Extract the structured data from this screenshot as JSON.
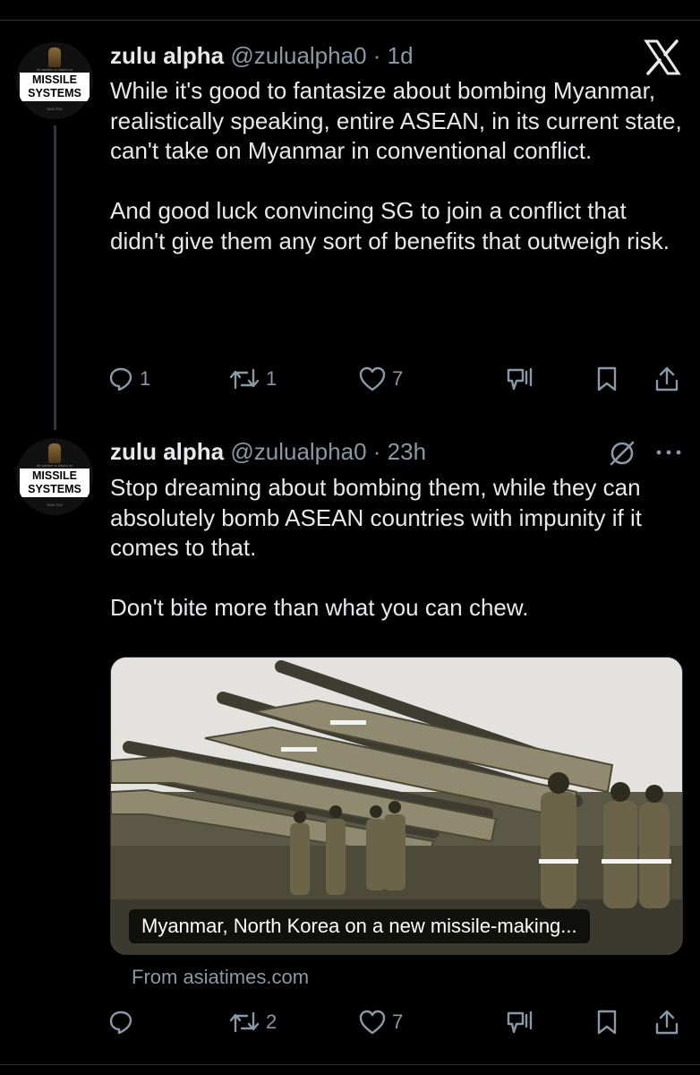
{
  "close_icon": "x-logo-icon",
  "tweets": [
    {
      "avatar": {
        "small_text": "All warfare is based on",
        "logo_line1": "MISSILE",
        "logo_line2": "SYSTEMS",
        "bottom_text": "SUN TZU"
      },
      "name": "zulu alpha",
      "handle": "@zulualpha0",
      "time": "· 1d",
      "text": "While it's good to fantasize about bombing Myanmar, realistically speaking, entire ASEAN, in its current state, can't take on Myanmar in conventional conflict.\n\nAnd good luck convincing SG to join a conflict that didn't give them any sort of benefits that outweigh risk.",
      "actions": {
        "replies": "1",
        "reposts": "1",
        "likes": "7"
      }
    },
    {
      "avatar": {
        "small_text": "All warfare is based on",
        "logo_line1": "MISSILE",
        "logo_line2": "SYSTEMS",
        "bottom_text": "SUN TZU"
      },
      "name": "zulu alpha",
      "handle": "@zulualpha0",
      "time": "· 23h",
      "text": "Stop dreaming about bombing them, while they can absolutely bomb ASEAN countries with impunity if it comes to that.\n\nDon't bite more than what you can chew.",
      "card": {
        "caption": "Myanmar, North Korea on a new missile-making...",
        "source": "From asiatimes.com"
      },
      "actions": {
        "replies": "",
        "reposts": "2",
        "likes": "7"
      }
    }
  ],
  "colors": {
    "background": "#000000",
    "text": "#e7e9ea",
    "muted": "#8b98a5",
    "divider": "#2f3336"
  }
}
